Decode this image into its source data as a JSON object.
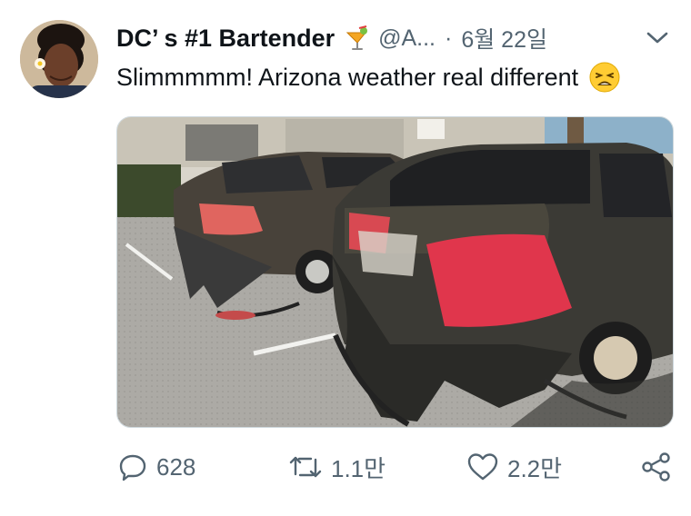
{
  "tweet": {
    "display_name": "DC’ s #1 Bartender",
    "handle": "@A...",
    "separator": "·",
    "date": "6월 22일",
    "text": "Slimmmmm! Arizona weather real different",
    "icons": {
      "name_emoji": "tropical-drink-icon",
      "text_emoji": "weary-face-icon",
      "menu": "chevron-down-icon",
      "reply": "reply-icon",
      "retweet": "retweet-icon",
      "like": "heart-icon",
      "share": "share-icon"
    }
  },
  "actions": {
    "reply_count": "628",
    "retweet_count": "1.1만",
    "like_count": "2.2만"
  },
  "colors": {
    "text_primary": "#0f1419",
    "text_secondary": "#536471",
    "border": "#cfd9de"
  }
}
